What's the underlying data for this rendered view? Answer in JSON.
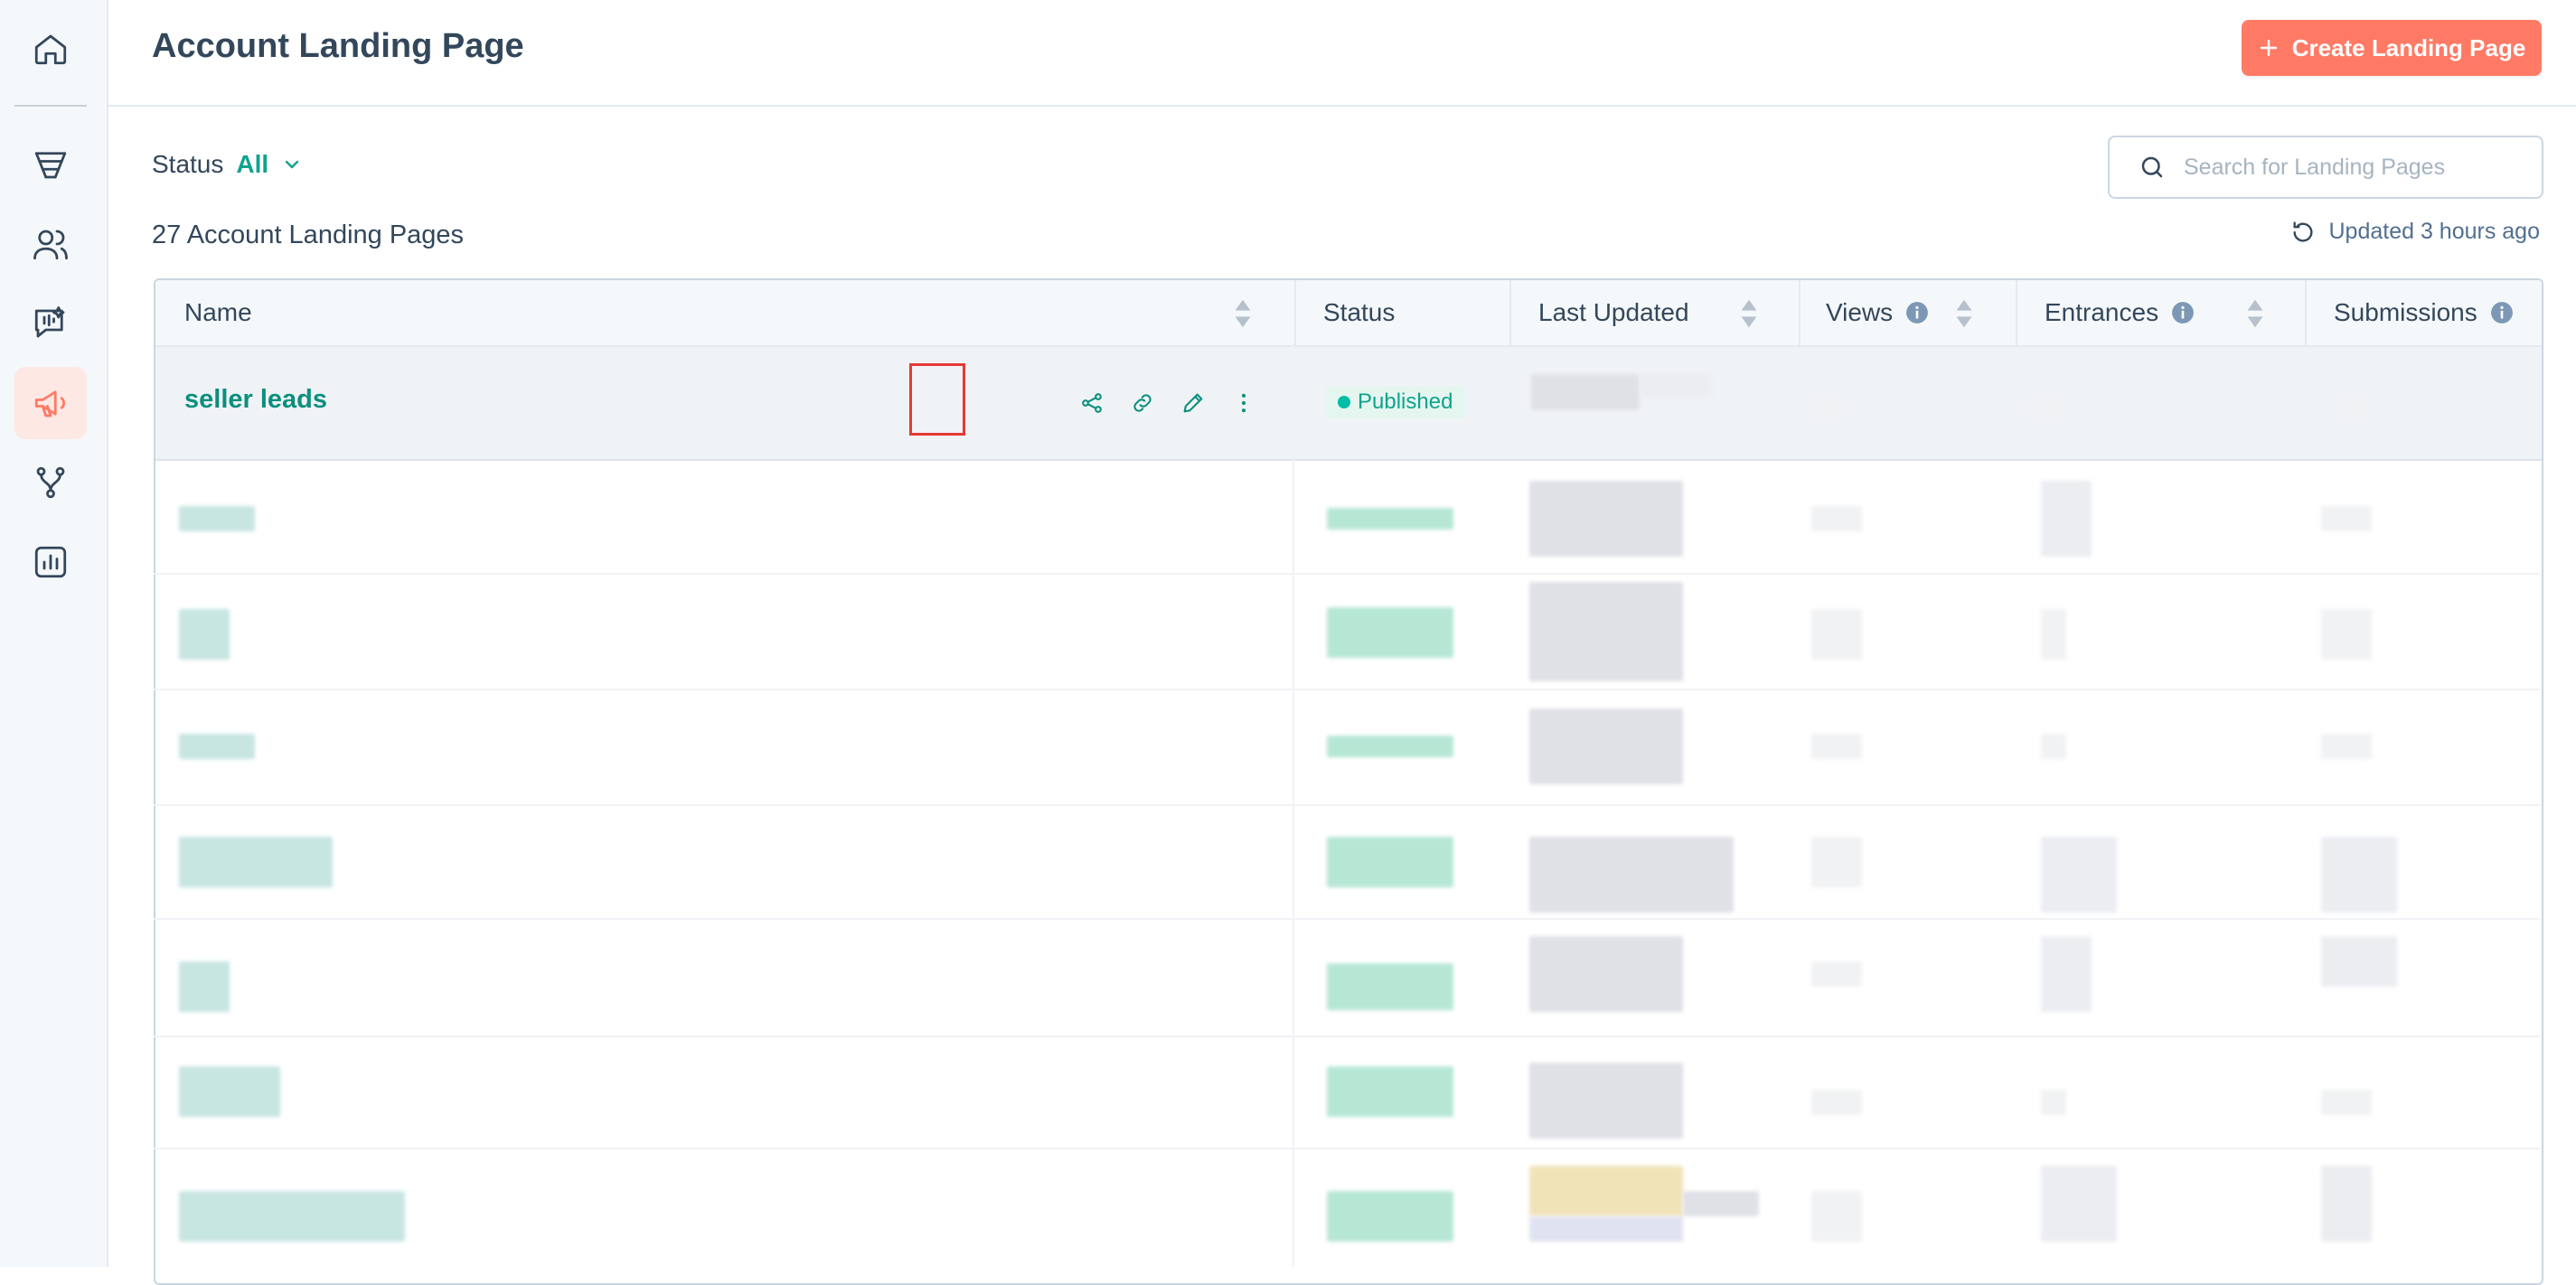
{
  "app": {
    "nav": [
      {
        "name": "home-icon",
        "active": false
      },
      {
        "name": "funnel-icon",
        "active": false
      },
      {
        "name": "contacts-icon",
        "active": false
      },
      {
        "name": "conversations-icon",
        "active": false
      },
      {
        "name": "marketing-megaphone-icon",
        "active": true
      },
      {
        "name": "automation-branch-icon",
        "active": false
      },
      {
        "name": "reports-chart-icon",
        "active": false
      }
    ],
    "accent_color": "#ff7a65",
    "brand_teal": "#0fa38c"
  },
  "header": {
    "title": "Account Landing Page",
    "create_button_label": "Create Landing Page"
  },
  "filters": {
    "status_label": "Status",
    "status_value": "All"
  },
  "search": {
    "placeholder": "Search for Landing Pages"
  },
  "summary": {
    "count_label": "27 Account Landing Pages",
    "updated_label": "Updated 3 hours ago"
  },
  "table": {
    "columns": [
      {
        "label": "Name",
        "sortable": true,
        "info": false
      },
      {
        "label": "Status",
        "sortable": false,
        "info": false
      },
      {
        "label": "Last Updated",
        "sortable": true,
        "info": false
      },
      {
        "label": "Views",
        "sortable": true,
        "info": true
      },
      {
        "label": "Entrances",
        "sortable": true,
        "info": true
      },
      {
        "label": "Submissions",
        "sortable": false,
        "info": true
      }
    ],
    "rows": [
      {
        "name": "seller leads",
        "status": "Published"
      }
    ],
    "row_actions": [
      "share-icon",
      "link-icon",
      "edit-pencil-icon",
      "more-vertical-icon"
    ]
  }
}
